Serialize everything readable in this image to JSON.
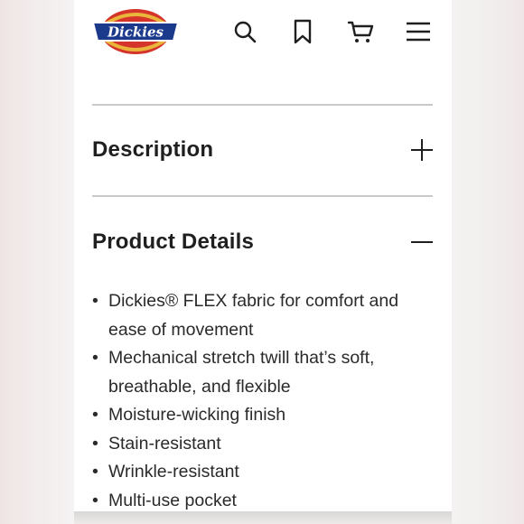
{
  "brand": {
    "logo_text": "Dickies",
    "colors": {
      "red": "#d4342a",
      "navy": "#1c3a8c",
      "gold": "#e9b53b"
    }
  },
  "header": {
    "icons": [
      "search-icon",
      "bookmark-icon",
      "cart-icon",
      "menu-icon"
    ]
  },
  "sections": {
    "description": {
      "title": "Description",
      "toggle": "+"
    },
    "product_details": {
      "title": "Product Details",
      "toggle": "−",
      "bullet": "•",
      "items": [
        "Dickies® FLEX fabric for comfort and ease of movement",
        "Mechanical stretch twill that’s soft, breathable, and flexible",
        "Moisture-wicking finish",
        "Stain-resistant",
        "Wrinkle-resistant",
        "Multi-use pocket"
      ]
    }
  }
}
